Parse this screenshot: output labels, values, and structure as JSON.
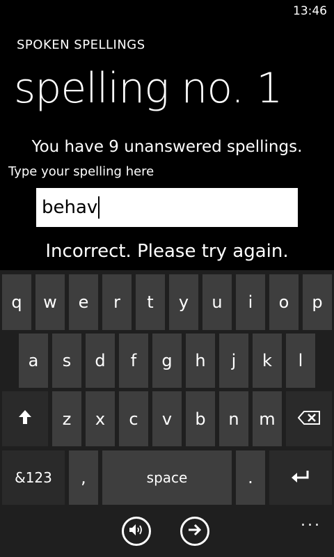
{
  "status_bar": {
    "time": "13:46"
  },
  "app": {
    "title": "SPOKEN SPELLINGS",
    "page_title": "spelling no. 1"
  },
  "quiz": {
    "info_text": "You have 9 unanswered spellings.",
    "input_hint": "Type your spelling here",
    "input_value": "behav",
    "feedback": "Incorrect. Please try again."
  },
  "keyboard": {
    "row1": [
      "q",
      "w",
      "e",
      "r",
      "t",
      "y",
      "u",
      "i",
      "o",
      "p"
    ],
    "row2": [
      "a",
      "s",
      "d",
      "f",
      "g",
      "h",
      "j",
      "k",
      "l"
    ],
    "row3": [
      "z",
      "x",
      "c",
      "v",
      "b",
      "n",
      "m"
    ],
    "symbols_label": "&123",
    "comma_label": ",",
    "space_label": "space",
    "period_label": ".",
    "shift_icon": "shift-arrow-icon",
    "backspace_icon": "backspace-icon",
    "enter_icon": "enter-icon"
  },
  "app_bar": {
    "buttons": [
      "speaker-icon",
      "next-arrow-icon"
    ],
    "more": "..."
  }
}
